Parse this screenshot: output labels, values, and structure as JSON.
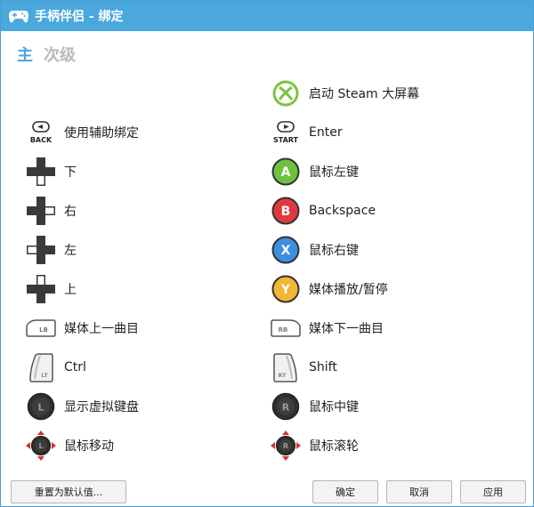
{
  "window": {
    "title": "手柄伴侣 - 绑定"
  },
  "tabs": {
    "main": "主",
    "secondary": "次级"
  },
  "left_bindings": [
    {
      "icon": "back-button-icon",
      "label": "使用辅助绑定"
    },
    {
      "icon": "dpad-down-icon",
      "label": "下"
    },
    {
      "icon": "dpad-right-icon",
      "label": "右"
    },
    {
      "icon": "dpad-left-icon",
      "label": "左"
    },
    {
      "icon": "dpad-up-icon",
      "label": "上"
    },
    {
      "icon": "lb-bumper-icon",
      "label": "媒体上一曲目"
    },
    {
      "icon": "lt-trigger-icon",
      "label": "Ctrl"
    },
    {
      "icon": "left-stick-click-icon",
      "label": "显示虚拟键盘"
    },
    {
      "icon": "left-stick-move-icon",
      "label": "鼠标移动"
    }
  ],
  "right_bindings": [
    {
      "icon": "xbox-guide-icon",
      "label": "启动 Steam 大屏幕"
    },
    {
      "icon": "start-button-icon",
      "label": "Enter"
    },
    {
      "icon": "a-button-icon",
      "label": "鼠标左键"
    },
    {
      "icon": "b-button-icon",
      "label": "Backspace"
    },
    {
      "icon": "x-button-icon",
      "label": "鼠标右键"
    },
    {
      "icon": "y-button-icon",
      "label": "媒体播放/暂停"
    },
    {
      "icon": "rb-bumper-icon",
      "label": "媒体下一曲目"
    },
    {
      "icon": "rt-trigger-icon",
      "label": "Shift"
    },
    {
      "icon": "right-stick-click-icon",
      "label": "鼠标中键"
    },
    {
      "icon": "right-stick-move-icon",
      "label": "鼠标滚轮"
    }
  ],
  "icon_text": {
    "back": "BACK",
    "start": "START",
    "a": "A",
    "b": "B",
    "x": "X",
    "y": "Y",
    "lb": "LB",
    "rb": "RB",
    "lt": "LT",
    "rt": "RT",
    "ls": "L",
    "rs": "R"
  },
  "buttons": {
    "reset": "重置为默认值...",
    "ok": "确定",
    "cancel": "取消",
    "apply": "应用"
  },
  "colors": {
    "titlebar": "#4aa8dd",
    "guide": "#7bc242",
    "a": "#6fc13e",
    "b": "#e0393e",
    "x": "#3b8ee0",
    "y": "#f2b632"
  }
}
